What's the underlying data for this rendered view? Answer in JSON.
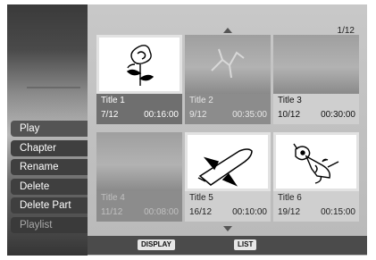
{
  "menu": [
    {
      "label": "Play",
      "enabled": true
    },
    {
      "label": "Chapter",
      "enabled": true
    },
    {
      "label": "Rename",
      "enabled": true
    },
    {
      "label": "Delete",
      "enabled": true
    },
    {
      "label": "Delete Part",
      "enabled": true
    },
    {
      "label": "Playlist",
      "enabled": false
    }
  ],
  "page_indicator": "1/12",
  "titles": [
    {
      "title": "Title 1",
      "index": "7/12",
      "duration": "00:16:00",
      "thumb": "rose-icon",
      "state": "selected"
    },
    {
      "title": "Title 2",
      "index": "9/12",
      "duration": "00:35:00",
      "thumb": "crack-icon",
      "state": "grey"
    },
    {
      "title": "Title 3",
      "index": "10/12",
      "duration": "00:30:00",
      "thumb": "blank-icon",
      "state": "grey"
    },
    {
      "title": "Title 4",
      "index": "11/12",
      "duration": "00:08:00",
      "thumb": "blank-icon",
      "state": "faded"
    },
    {
      "title": "Title 5",
      "index": "16/12",
      "duration": "00:10:00",
      "thumb": "shuttle-icon",
      "state": "white"
    },
    {
      "title": "Title 6",
      "index": "19/12",
      "duration": "00:15:00",
      "thumb": "dog-icon",
      "state": "white"
    }
  ],
  "footer": {
    "display_label": "DISPLAY",
    "list_label": "LIST"
  }
}
